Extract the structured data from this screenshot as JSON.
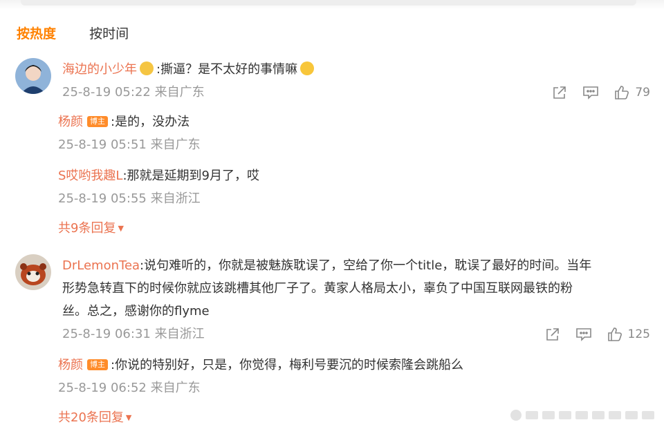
{
  "sort": {
    "hot": "按热度",
    "time": "按时间"
  },
  "comments": [
    {
      "user": "海边的小少年",
      "text": ":撕逼？是不太好的事情嘛",
      "time": "25-8-19 05:22 来自广东",
      "likes": "79",
      "replies": [
        {
          "user": "杨颜",
          "badge": "博主",
          "text": ":是的，没办法",
          "time": "25-8-19 05:51 来自广东"
        },
        {
          "user": "S哎哟我趣L",
          "text": ":那就是延期到9月了，哎",
          "time": "25-8-19 05:55 来自浙江"
        }
      ],
      "more": "共9条回复"
    },
    {
      "user": "DrLemonTea",
      "text_line1": ":说句难听的，你就是被魅族耽误了，空给了你一个title，耽误了最好的时间。当年",
      "text_line2": "形势急转直下的时候你就应该跳槽其他厂子了。黄家人格局太小，辜负了中国互联网最铁的粉",
      "text_line3": "丝。总之，感谢你的flyme",
      "time": "25-8-19 06:31 来自浙江",
      "likes": "125",
      "replies": [
        {
          "user": "杨颜",
          "badge": "博主",
          "text": ":你说的特别好，只是，你觉得，梅利号要沉的时候索隆会跳船么",
          "time": "25-8-19 06:52 来自广东"
        }
      ],
      "more": "共20条回复"
    }
  ],
  "icons": {
    "share": "share-icon",
    "comment": "comment-icon",
    "like": "like-icon"
  },
  "colors": {
    "accent": "#ff8200",
    "username": "#eb7350",
    "meta": "#999999"
  }
}
